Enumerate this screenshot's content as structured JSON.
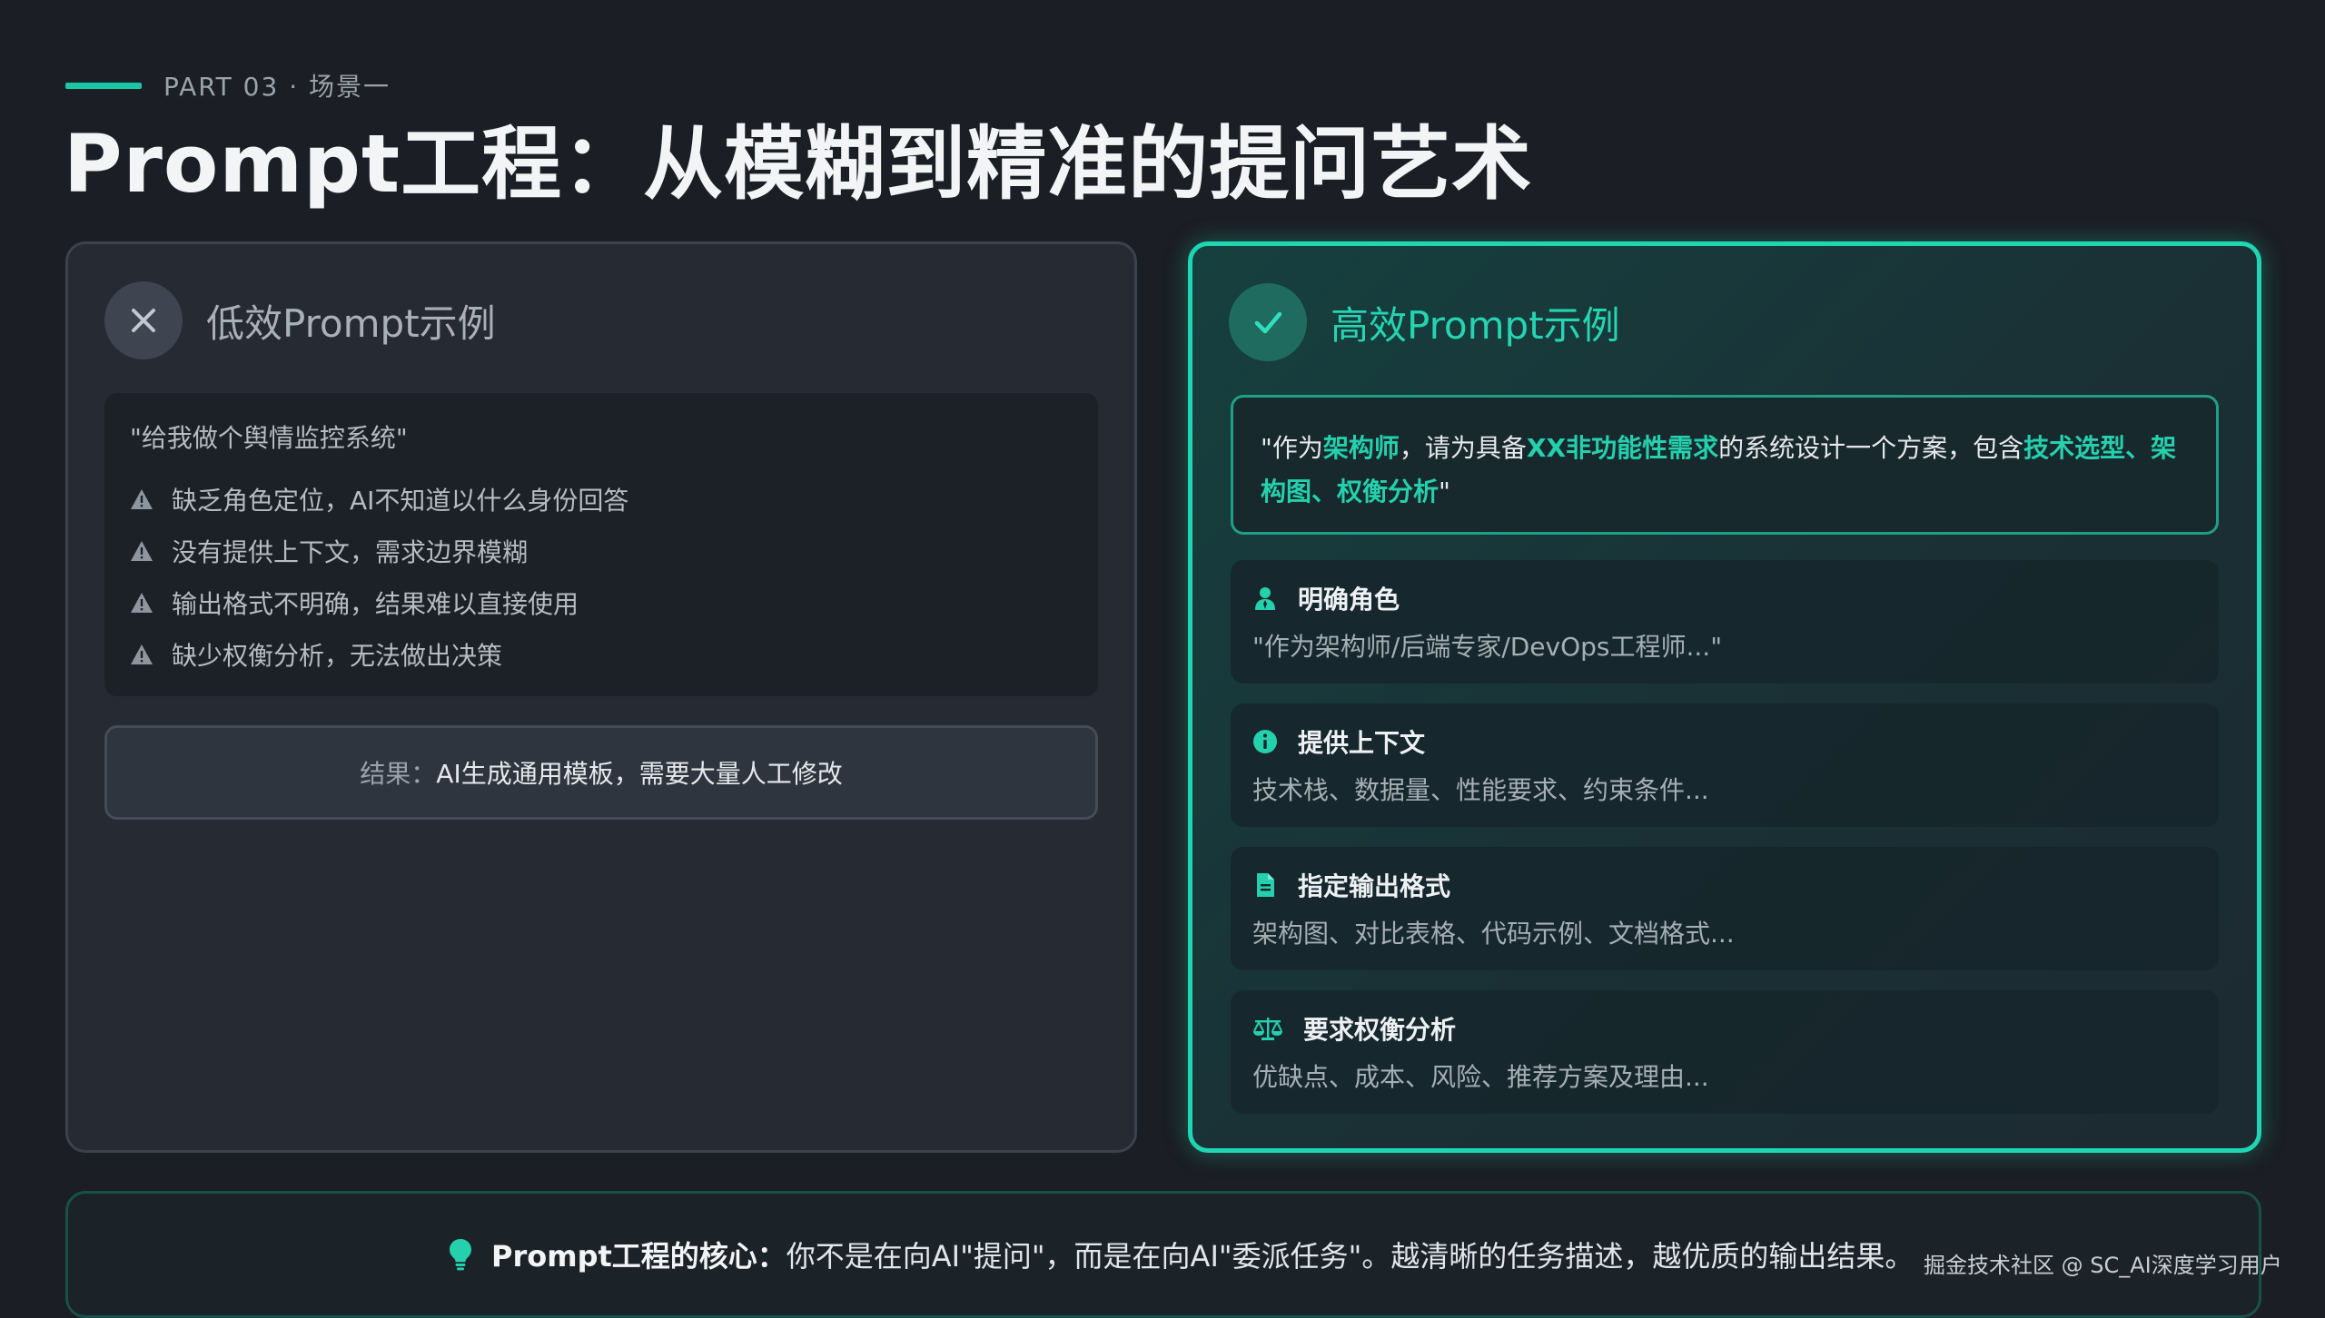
{
  "header": {
    "part_label": "PART 03 · 场景一",
    "title": "Prompt工程：从模糊到精准的提问艺术"
  },
  "bad_card": {
    "title": "低效Prompt示例",
    "quote": "\"给我做个舆情监控系统\"",
    "issues": [
      "缺乏角色定位，AI不知道以什么身份回答",
      "没有提供上下文，需求边界模糊",
      "输出格式不明确，结果难以直接使用",
      "缺少权衡分析，无法做出决策"
    ],
    "result_label": "结果：",
    "result_text": "AI生成通用模板，需要大量人工修改"
  },
  "good_card": {
    "title": "高效Prompt示例",
    "quote_parts": {
      "p1": "\"作为",
      "h1": "架构师",
      "p2": "，请为具备",
      "h2": "XX非功能性需求",
      "p3": "的系统设计一个方案，包含",
      "h3": "技术选型、架构图、权衡分析",
      "p4": "\""
    },
    "features": [
      {
        "icon": "user-icon",
        "title": "明确角色",
        "desc": "\"作为架构师/后端专家/DevOps工程师...\""
      },
      {
        "icon": "info-icon",
        "title": "提供上下文",
        "desc": "技术栈、数据量、性能要求、约束条件..."
      },
      {
        "icon": "document-icon",
        "title": "指定输出格式",
        "desc": "架构图、对比表格、代码示例、文档格式..."
      },
      {
        "icon": "scale-icon",
        "title": "要求权衡分析",
        "desc": "优缺点、成本、风险、推荐方案及理由..."
      }
    ]
  },
  "footer": {
    "strong": "Prompt工程的核心：",
    "text": "你不是在向AI\"提问\"，而是在向AI\"委派任务\"。越清晰的任务描述，越优质的输出结果。"
  },
  "watermark": "掘金技术社区 @ SC_AI深度学习用户",
  "colors": {
    "accent": "#1fd6b3",
    "background": "#1b1e24",
    "card_left": "#252a33"
  }
}
